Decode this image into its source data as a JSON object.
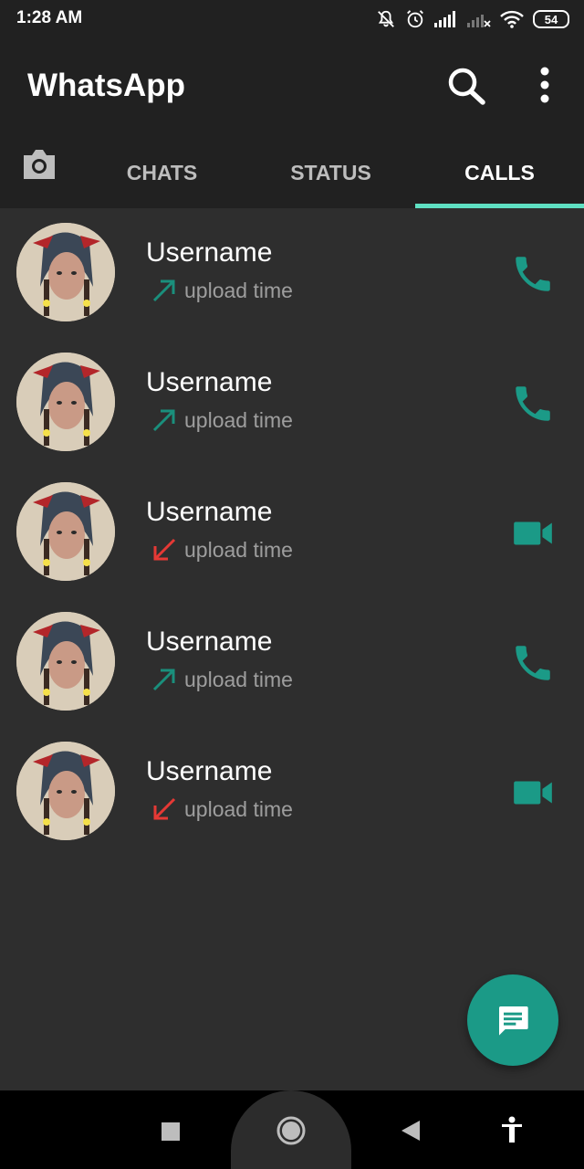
{
  "status_bar": {
    "time": "1:28 AM",
    "battery": "54",
    "icons": [
      "mute-bell-icon",
      "alarm-icon",
      "signal-icon",
      "signal-weak-icon",
      "wifi-icon",
      "battery-icon"
    ]
  },
  "app_bar": {
    "title": "WhatsApp",
    "actions": [
      "search-icon",
      "more-options-icon"
    ]
  },
  "tabs": {
    "camera_icon": "camera-icon",
    "items": [
      {
        "label": "CHATS",
        "active": false
      },
      {
        "label": "STATUS",
        "active": false
      },
      {
        "label": "CALLS",
        "active": true
      }
    ]
  },
  "calls": [
    {
      "name": "Username",
      "time": "upload time",
      "direction": "outgoing",
      "call_type": "voice"
    },
    {
      "name": "Username",
      "time": "upload time",
      "direction": "outgoing",
      "call_type": "voice"
    },
    {
      "name": "Username",
      "time": "upload time",
      "direction": "missed-incoming",
      "call_type": "video"
    },
    {
      "name": "Username",
      "time": "upload time",
      "direction": "outgoing",
      "call_type": "voice"
    },
    {
      "name": "Username",
      "time": "upload time",
      "direction": "missed-incoming",
      "call_type": "video"
    }
  ],
  "fab": {
    "icon": "message-icon"
  },
  "nav_bar": {
    "items": [
      "recents-square-icon",
      "home-circle-icon",
      "back-triangle-icon",
      "accessibility-icon"
    ]
  },
  "colors": {
    "background": "#2e2e2e",
    "app_bar": "#212121",
    "accent": "#1b9a87",
    "tab_indicator": "#5fe0c2",
    "outgoing_arrow": "#1a8f7c",
    "missed_arrow": "#e53935"
  }
}
